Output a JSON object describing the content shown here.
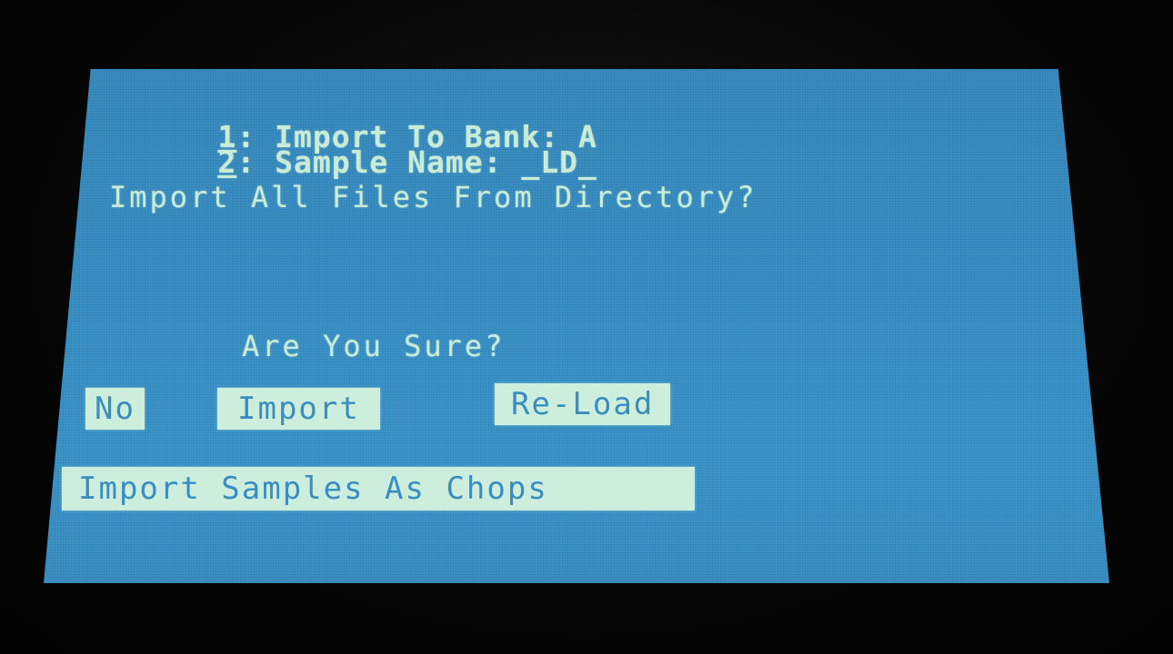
{
  "header": {
    "line1": {
      "num": "1",
      "text": ": Import To Bank: A"
    },
    "line2": {
      "num": "2",
      "text": ": Sample Name: _LD_"
    }
  },
  "main": {
    "prompt": "Import All Files From Directory?",
    "confirm": "Are You Sure?"
  },
  "buttons": {
    "no": "No",
    "import": "Import",
    "reload": "Re-Load",
    "import_chops": "Import Samples As Chops"
  },
  "colors": {
    "screen_bg": "#3b95cb",
    "lcd_text": "#c9ecd6",
    "bezel": "#060606"
  }
}
